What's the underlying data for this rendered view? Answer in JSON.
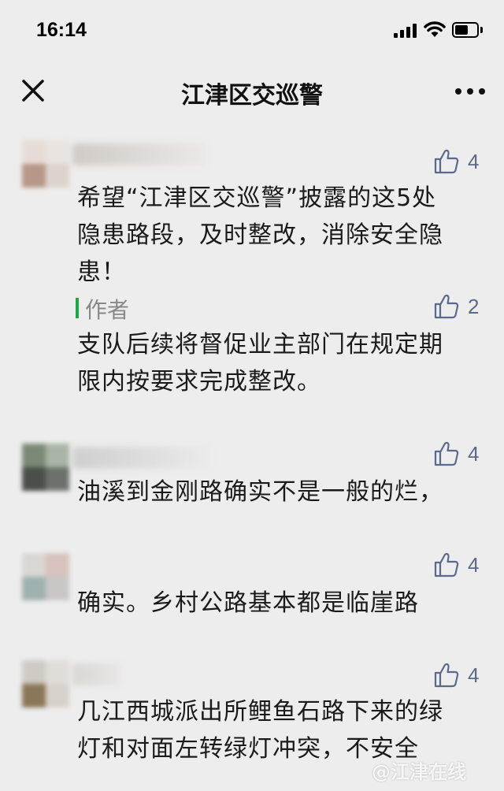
{
  "status": {
    "time": "16:14"
  },
  "nav": {
    "title": "江津区交巡警",
    "close_icon": "close-icon",
    "more_icon": "more-icon"
  },
  "comments": [
    {
      "likes": "4",
      "text_lines": [
        "希望“江津区交巡警”披露的这5处",
        "隐患路段，及时整改，消除安全隐",
        "患！"
      ],
      "reply": {
        "label": "作者",
        "likes": "2",
        "text_lines": [
          "支队后续将督促业主部门在规定期",
          "限内按要求完成整改。"
        ]
      }
    },
    {
      "likes": "4",
      "text_lines": [
        "油溪到金刚路确实不是一般的烂，"
      ]
    },
    {
      "likes": "4",
      "text_lines": [
        "确实。乡村公路基本都是临崖路"
      ]
    },
    {
      "likes": "4",
      "text_lines": [
        "几江西城派出所鲤鱼石路下来的绿",
        "灯和对面左转绿灯冲突，不安全"
      ]
    }
  ],
  "watermark": "@江津在线",
  "colors": {
    "background": "#ededed",
    "like": "#5b6a8c",
    "author_bar": "#22a34a"
  }
}
